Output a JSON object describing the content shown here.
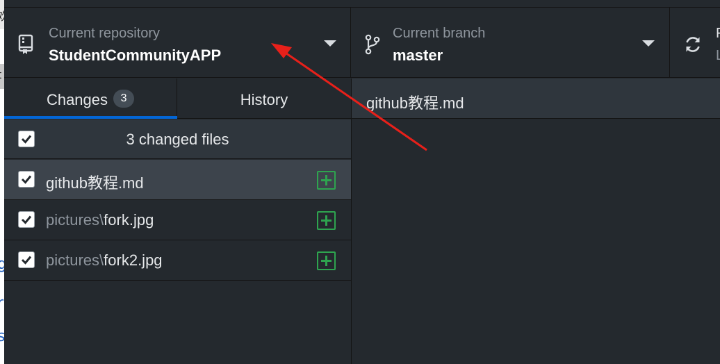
{
  "toolbar": {
    "repository": {
      "title": "Current repository",
      "value": "StudentCommunityAPP",
      "icon": "repo-icon"
    },
    "branch": {
      "title": "Current branch",
      "value": "master",
      "icon": "git-branch-icon"
    },
    "fetch": {
      "icon": "sync-icon",
      "title_partial": "F",
      "value_partial": "L"
    }
  },
  "tabs": {
    "changes": {
      "label": "Changes",
      "count": "3"
    },
    "history": {
      "label": "History"
    }
  },
  "changes": {
    "summary": "3 changed files",
    "files": [
      {
        "dir": "",
        "name": "github教程.md",
        "status": "added",
        "checked": true,
        "selected": true
      },
      {
        "dir": "pictures\\",
        "name": "fork.jpg",
        "status": "added",
        "checked": true,
        "selected": false
      },
      {
        "dir": "pictures\\",
        "name": "fork2.jpg",
        "status": "added",
        "checked": true,
        "selected": false
      }
    ]
  },
  "diff": {
    "file": "github教程.md"
  },
  "background_window": {
    "chars": [
      "欢",
      "t",
      "g",
      "r",
      "s"
    ]
  },
  "colors": {
    "accent": "#0366d6",
    "added": "#2ea44f",
    "annotation_arrow": "#e8201a"
  }
}
